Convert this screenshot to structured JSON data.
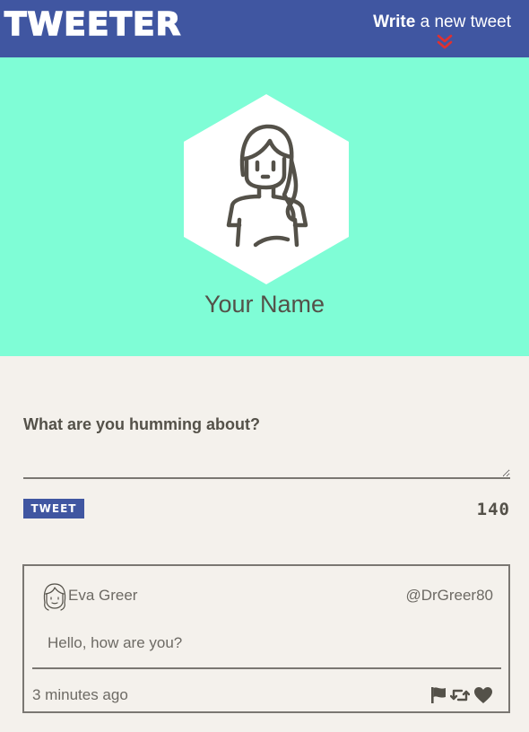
{
  "nav": {
    "logo": "TWEETER",
    "compose_bold": "Write",
    "compose_rest": " a new tweet",
    "compose_icon": "double-chevron-down-icon"
  },
  "profile": {
    "name": "Your Name",
    "avatar_icon": "user-avatar-icon"
  },
  "compose": {
    "label": "What are you humming about?",
    "value": "",
    "button_label": "TWEET",
    "counter": "140"
  },
  "tweets": [
    {
      "author": "Eva Greer",
      "handle": "@DrGreer80",
      "content": "Hello, how are you?",
      "timestamp": "3 minutes ago",
      "actions": [
        "flag-icon",
        "retweet-icon",
        "heart-icon"
      ]
    }
  ],
  "colors": {
    "nav_bg": "#4056a1",
    "header_bg": "#7ffdd6",
    "page_bg": "#f4f1ec",
    "text": "#545149",
    "accent": "#e0302f"
  }
}
